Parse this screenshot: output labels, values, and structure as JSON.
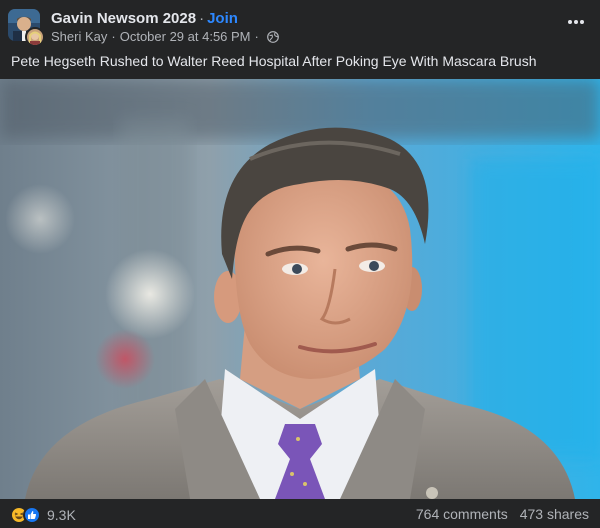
{
  "post": {
    "group_name": "Gavin Newsom 2028",
    "join_label": "Join",
    "author": "Sheri Kay",
    "timestamp": "October 29 at 4:56 PM",
    "caption": "Pete Hegseth Rushed to Walter Reed Hospital After Poking Eye With Mascara Brush",
    "photo_icon": "photo-of-man-in-gray-suit",
    "privacy_icon": "globe-icon",
    "more_icon": "more-options-icon"
  },
  "footer": {
    "reaction_icons": [
      "haha-emoji-icon",
      "like-icon"
    ],
    "reaction_count": "9.3K",
    "comments": "764 comments",
    "shares": "473 shares"
  },
  "colors": {
    "background": "#242526",
    "text_primary": "#e4e6eb",
    "text_secondary": "#b0b3b8",
    "link_blue": "#2d88ff",
    "like_blue": "#1877f2",
    "haha_yellow": "#f7b928"
  }
}
